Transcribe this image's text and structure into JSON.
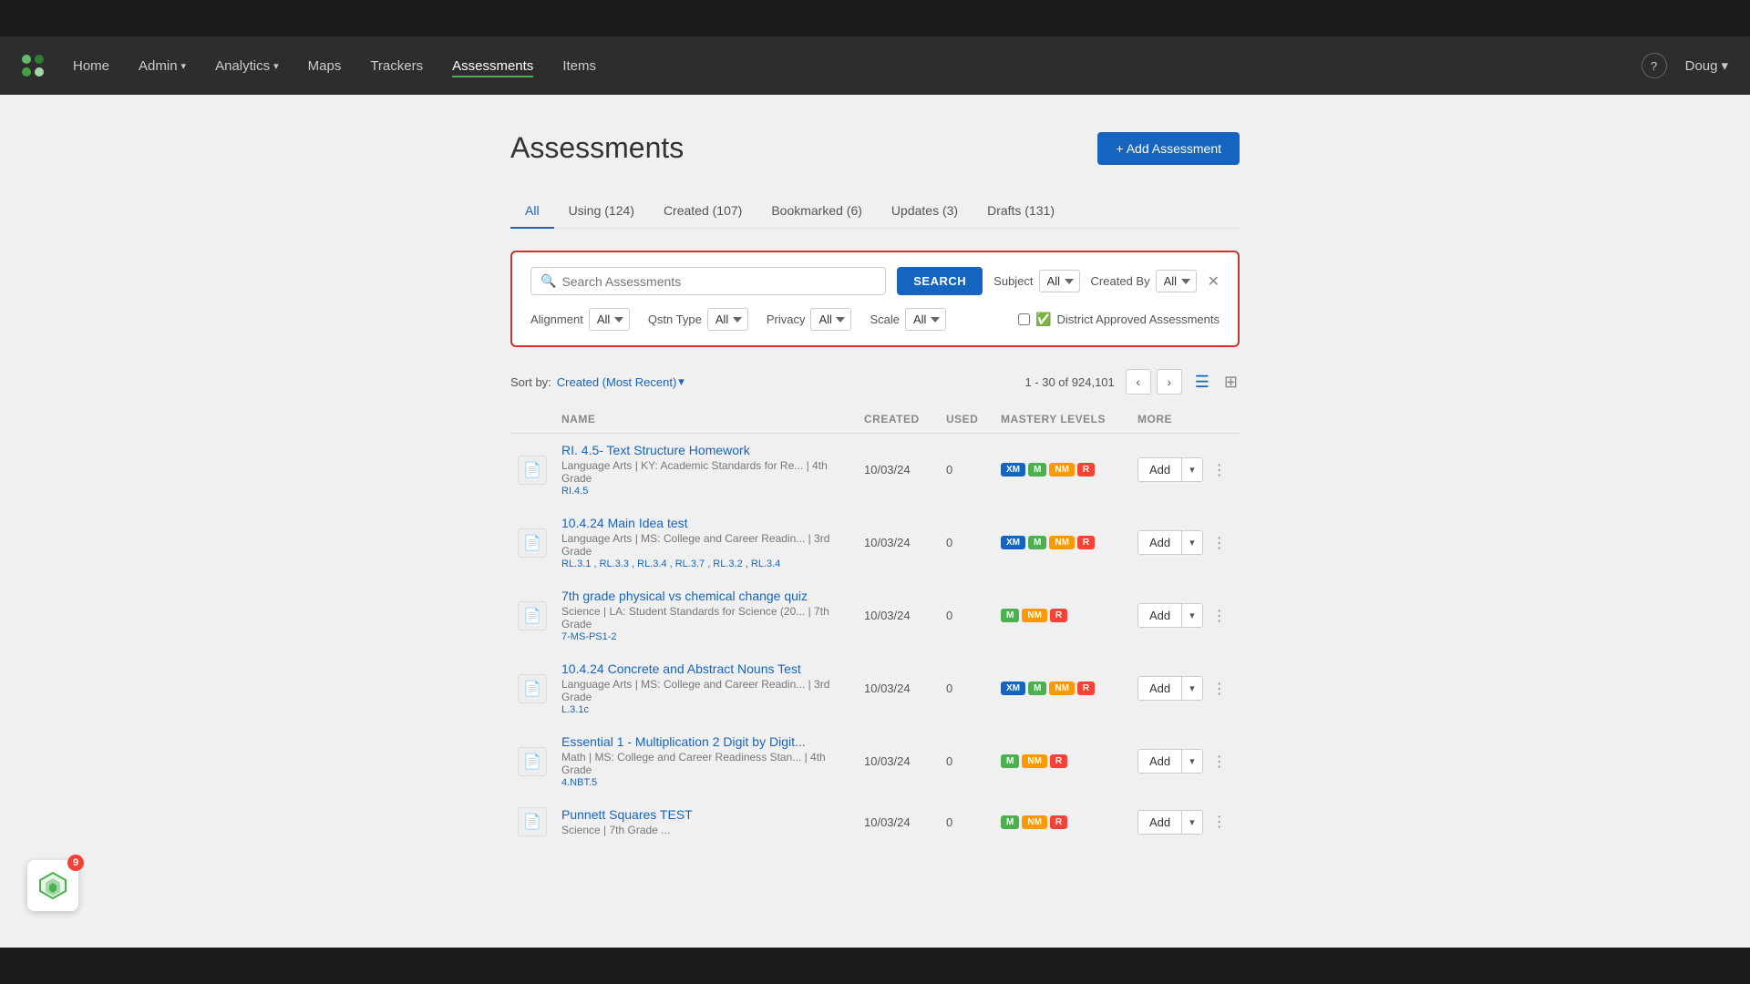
{
  "topBar": {
    "bg": "#1a1a1a"
  },
  "navbar": {
    "logo": "logo",
    "items": [
      {
        "id": "home",
        "label": "Home",
        "active": false
      },
      {
        "id": "admin",
        "label": "Admin",
        "dropdown": true,
        "active": false
      },
      {
        "id": "analytics",
        "label": "Analytics",
        "dropdown": true,
        "active": false
      },
      {
        "id": "maps",
        "label": "Maps",
        "dropdown": false,
        "active": false
      },
      {
        "id": "trackers",
        "label": "Trackers",
        "dropdown": false,
        "active": false
      },
      {
        "id": "assessments",
        "label": "Assessments",
        "dropdown": false,
        "active": true
      },
      {
        "id": "items",
        "label": "Items",
        "dropdown": false,
        "active": false
      }
    ],
    "user": "Doug",
    "help": "?"
  },
  "page": {
    "title": "Assessments",
    "addButton": "+ Add Assessment"
  },
  "tabs": [
    {
      "id": "all",
      "label": "All",
      "active": true
    },
    {
      "id": "using",
      "label": "Using (124)",
      "active": false
    },
    {
      "id": "created",
      "label": "Created (107)",
      "active": false
    },
    {
      "id": "bookmarked",
      "label": "Bookmarked (6)",
      "active": false
    },
    {
      "id": "updates",
      "label": "Updates (3)",
      "active": false
    },
    {
      "id": "drafts",
      "label": "Drafts (131)",
      "active": false
    }
  ],
  "searchPanel": {
    "placeholder": "Search Assessments",
    "searchButton": "SEARCH",
    "subjectLabel": "Subject",
    "subjectValue": "All",
    "createdByLabel": "Created By",
    "createdByValue": "All",
    "alignmentLabel": "Alignment",
    "alignmentValue": "All",
    "qstnTypeLabel": "Qstn Type",
    "qstnTypeValue": "All",
    "privacyLabel": "Privacy",
    "privacyValue": "All",
    "scaleLabel": "Scale",
    "scaleValue": "All",
    "districtLabel": "District Approved Assessments"
  },
  "resultsBar": {
    "sortByLabel": "Sort by:",
    "sortValue": "Created (Most Recent)",
    "pageInfo": "1 - 30 of 924,101",
    "chevronDown": "▾"
  },
  "tableHeaders": {
    "name": "NAME",
    "created": "CREATED",
    "used": "USED",
    "masteryLevels": "MASTERY LEVELS",
    "more": "MORE"
  },
  "assessments": [
    {
      "id": 1,
      "name": "RI. 4.5- Text Structure Homework",
      "meta": "Language Arts  |  KY: Academic Standards for Re...  |  4th Grade",
      "standards": "RI.4.5",
      "created": "10/03/24",
      "used": "0",
      "mastery": [
        "XM",
        "M",
        "NM",
        "R"
      ]
    },
    {
      "id": 2,
      "name": "10.4.24 Main Idea test",
      "meta": "Language Arts  |  MS: College and Career Readin...  |  3rd Grade",
      "standards": "RL.3.1 , RL.3.3 , RL.3.4 , RL.3.7 , RL.3.2 , RL.3.4",
      "created": "10/03/24",
      "used": "0",
      "mastery": [
        "XM",
        "M",
        "NM",
        "R"
      ]
    },
    {
      "id": 3,
      "name": "7th grade physical vs chemical change quiz",
      "meta": "Science  |  LA: Student Standards for Science (20...  |  7th Grade",
      "standards": "7-MS-PS1-2",
      "created": "10/03/24",
      "used": "0",
      "mastery": [
        "M",
        "NM",
        "R"
      ]
    },
    {
      "id": 4,
      "name": "10.4.24 Concrete and Abstract Nouns Test",
      "meta": "Language Arts  |  MS: College and Career Readin...  |  3rd Grade",
      "standards": "L.3.1c",
      "created": "10/03/24",
      "used": "0",
      "mastery": [
        "XM",
        "M",
        "NM",
        "R"
      ]
    },
    {
      "id": 5,
      "name": "Essential 1 - Multiplication 2 Digit by Digit...",
      "meta": "Math  |  MS: College and Career Readiness Stan...  |  4th Grade",
      "standards": "4.NBT.5",
      "created": "10/03/24",
      "used": "0",
      "mastery": [
        "M",
        "NM",
        "R"
      ]
    },
    {
      "id": 6,
      "name": "Punnett Squares TEST",
      "meta": "Science  |  7th Grade  ...",
      "standards": "",
      "created": "10/03/24",
      "used": "0",
      "mastery": [
        "M",
        "NM",
        "R"
      ]
    }
  ],
  "widget": {
    "badge": "9"
  },
  "masteryColors": {
    "XM": "#1565c0",
    "M": "#4caf50",
    "NM": "#ff9800",
    "R": "#f44336"
  }
}
